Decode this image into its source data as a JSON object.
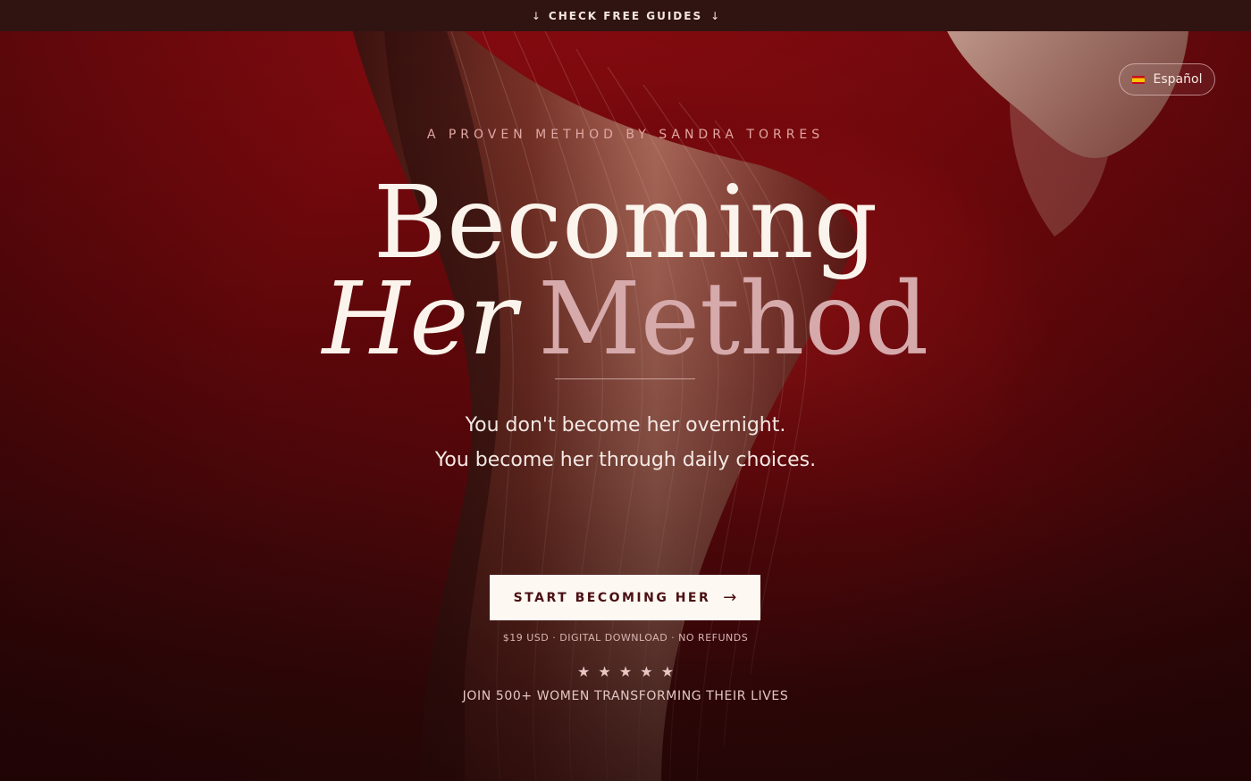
{
  "top_bar": {
    "arrow_icon": "arrow-down-icon",
    "label": "CHECK FREE GUIDES"
  },
  "language": {
    "flag_icon": "spain-flag-icon",
    "label": "Español"
  },
  "hero": {
    "eyebrow": "A PROVEN METHOD BY SANDRA TORRES",
    "title_line1": "Becoming",
    "title_her": "Her",
    "title_method": "Method",
    "subtitle_line1": "You don't become her overnight.",
    "subtitle_line2": "You become her through daily choices."
  },
  "cta": {
    "label": "START BECOMING HER",
    "arrow_icon": "arrow-right-icon",
    "note": "$19 USD · DIGITAL DOWNLOAD · NO REFUNDS"
  },
  "rating": {
    "stars": 5,
    "star_icon": "star-icon",
    "social_proof": "JOIN 500+ WOMEN TRANSFORMING THEIR LIVES"
  },
  "colors": {
    "top_bar_bg": "#2f1412",
    "hero_red": "#8a0b10",
    "cream": "#fbf4ec",
    "rose": "#d6a9ab",
    "cta_text": "#4a0f13"
  }
}
